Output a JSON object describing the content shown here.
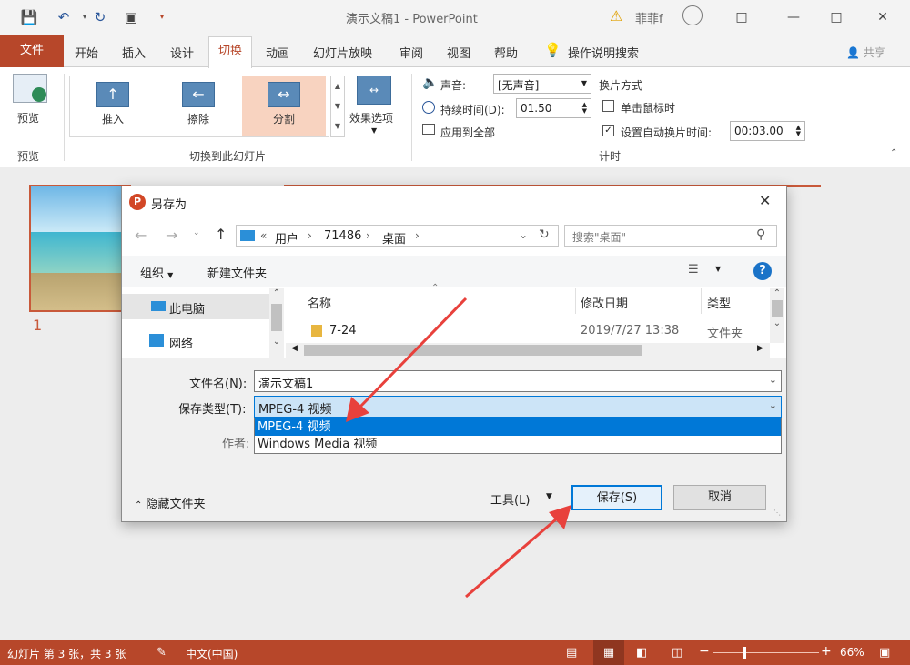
{
  "titlebar": {
    "doc_title": "演示文稿1  -  PowerPoint",
    "user": "菲菲f",
    "warning_icon": "warning-icon"
  },
  "tabs": [
    "文件",
    "开始",
    "插入",
    "设计",
    "切换",
    "动画",
    "幻灯片放映",
    "审阅",
    "视图",
    "帮助"
  ],
  "tell_me": "操作说明搜索",
  "share": "共享",
  "ribbon": {
    "preview_label": "预览",
    "preview_group": "预览",
    "transitions": [
      "推入",
      "擦除",
      "分割"
    ],
    "effect_options": "效果选项",
    "transitions_group": "切换到此幻灯片",
    "sound_label": "声音:",
    "sound_value": "[无声音]",
    "duration_label": "持续时间(D):",
    "duration_value": "01.50",
    "apply_all": "应用到全部",
    "advance_title": "换片方式",
    "on_click": "单击鼠标时",
    "after_label": "设置自动换片时间:",
    "after_value": "00:03.00",
    "timing_group": "计时"
  },
  "thumbnail_number": "1",
  "dialog": {
    "title": "另存为",
    "path": [
      "用户",
      "71486",
      "桌面"
    ],
    "search_placeholder": "搜索\"桌面\"",
    "organize": "组织",
    "new_folder": "新建文件夹",
    "nav_items": [
      "此电脑",
      "网络"
    ],
    "columns": [
      "名称",
      "修改日期",
      "类型"
    ],
    "files": [
      {
        "name": "7-24",
        "date": "2019/7/27 13:38",
        "type": "文件夹"
      }
    ],
    "filename_label": "文件名(N):",
    "filename_value": "演示文稿1",
    "filetype_label": "保存类型(T):",
    "filetype_value": "MPEG-4 视频",
    "author_label": "作者:",
    "dropdown_options": [
      "MPEG-4 视频",
      "Windows Media 视频"
    ],
    "hide_folders": "隐藏文件夹",
    "tools": "工具(L)",
    "save": "保存(S)",
    "cancel": "取消"
  },
  "statusbar": {
    "slide_info": "幻灯片 第 3 张，共 3 张",
    "language": "中文(中国)",
    "zoom": "66%"
  },
  "colors": {
    "accent": "#b7472a",
    "selection": "#0078d7"
  }
}
